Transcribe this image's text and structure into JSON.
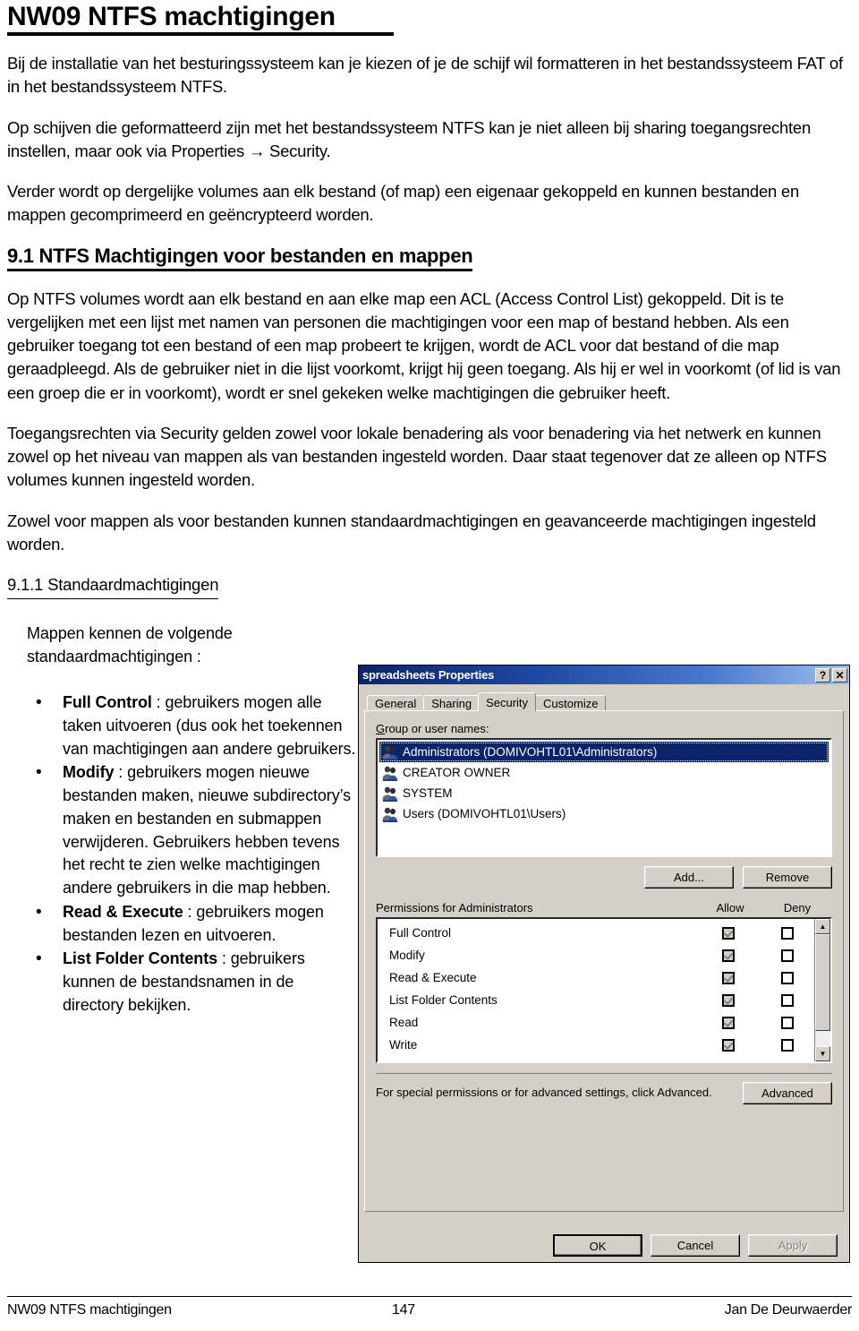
{
  "document": {
    "title": "NW09 NTFS machtigingen",
    "paragraphs": [
      "Bij de installatie van het besturingssysteem kan je kiezen of je de schijf wil formatteren in het bestandssysteem FAT of in het bestandssysteem NTFS.",
      "Op schijven die geformatteerd zijn met het bestandssysteem NTFS kan je niet alleen bij sharing toegangsrechten instellen, maar ook via Properties → Security.",
      "Verder wordt op dergelijke volumes aan elk bestand (of map) een eigenaar gekoppeld en kunnen bestanden en mappen gecomprimeerd en geëncrypteerd worden."
    ],
    "section_9_1": {
      "heading": "9.1  NTFS Machtigingen voor bestanden en mappen",
      "paragraphs": [
        "Op NTFS volumes wordt aan elk bestand en aan elke map een ACL (Access Control List) gekoppeld.  Dit is te vergelijken met een lijst met namen van personen die machtigingen voor een map of bestand hebben.  Als een gebruiker toegang tot een bestand of een map probeert te krijgen, wordt de ACL voor dat bestand of die map geraadpleegd.  Als de gebruiker niet in die lijst voorkomt, krijgt hij geen toegang.  Als hij er wel in voorkomt (of lid is van een groep die er in voorkomt), wordt er snel gekeken welke machtigingen die gebruiker heeft.",
        "Toegangsrechten via Security gelden zowel voor lokale benadering als voor benadering via het netwerk en kunnen zowel op het niveau van mappen als van bestanden ingesteld worden.  Daar staat tegenover dat ze alleen op NTFS volumes kunnen ingesteld worden.",
        "Zowel voor mappen als voor bestanden kunnen standaardmachtigingen en geavanceerde machtigingen ingesteld worden."
      ]
    },
    "section_9_1_1": {
      "heading": "9.1.1 Standaardmachtigingen",
      "lead": "Mappen kennen de volgende standaardmachtigingen :",
      "bullets": [
        {
          "term": "Full Control",
          "separator": " : ",
          "text": "gebruikers mogen alle taken uitvoeren (dus ook het toekennen van machtigingen aan andere gebruikers."
        },
        {
          "term": "Modify",
          "separator": " : ",
          "text": "gebruikers mogen nieuwe bestanden maken, nieuwe subdirectory’s maken en bestanden en submappen verwijderen.  Gebruikers hebben tevens het recht te zien welke machtigingen andere gebruikers in die map hebben."
        },
        {
          "term": "Read & Execute",
          "separator": " : ",
          "text": "gebruikers mogen bestanden lezen en uitvoeren."
        },
        {
          "term": "List Folder Contents",
          "separator": " : ",
          "text": "gebruikers kunnen de bestandsnamen in de directory bekijken."
        }
      ]
    }
  },
  "dialog": {
    "title": "spreadsheets Properties",
    "titlebar_buttons": {
      "help": "?",
      "close": "✕"
    },
    "tabs": [
      {
        "label": "General",
        "active": false
      },
      {
        "label": "Sharing",
        "active": false
      },
      {
        "label": "Security",
        "active": true
      },
      {
        "label": "Customize",
        "active": false
      }
    ],
    "group_label": "Group or user names:",
    "group_items": [
      {
        "name": "Administrators (DOMIVOHTL01\\Administrators)",
        "selected": true
      },
      {
        "name": "CREATOR OWNER",
        "selected": false
      },
      {
        "name": "SYSTEM",
        "selected": false
      },
      {
        "name": "Users (DOMIVOHTL01\\Users)",
        "selected": false
      }
    ],
    "add_button": "Add...",
    "remove_button": "Remove",
    "permissions_label": "Permissions for Administrators",
    "col_allow": "Allow",
    "col_deny": "Deny",
    "permissions": [
      {
        "name": "Full Control",
        "allow": "checked-gray",
        "deny": "unchecked"
      },
      {
        "name": "Modify",
        "allow": "checked-gray",
        "deny": "unchecked"
      },
      {
        "name": "Read & Execute",
        "allow": "checked-gray",
        "deny": "unchecked"
      },
      {
        "name": "List Folder Contents",
        "allow": "checked-gray",
        "deny": "unchecked"
      },
      {
        "name": "Read",
        "allow": "checked-gray",
        "deny": "unchecked"
      },
      {
        "name": "Write",
        "allow": "checked-gray",
        "deny": "unchecked"
      }
    ],
    "advanced_text": "For special permissions or for advanced settings, click Advanced.",
    "advanced_button": "Advanced",
    "ok_button": "OK",
    "cancel_button": "Cancel",
    "apply_button": "Apply",
    "apply_disabled": true,
    "colors": {
      "titlebar_start": "#0a246a",
      "titlebar_end": "#9cc0ee",
      "face": "#d4d0c8",
      "selection": "#0a246a"
    }
  },
  "footer": {
    "left": "NW09 NTFS machtigingen",
    "page_number": "147",
    "right": "Jan De Deurwaerder"
  }
}
